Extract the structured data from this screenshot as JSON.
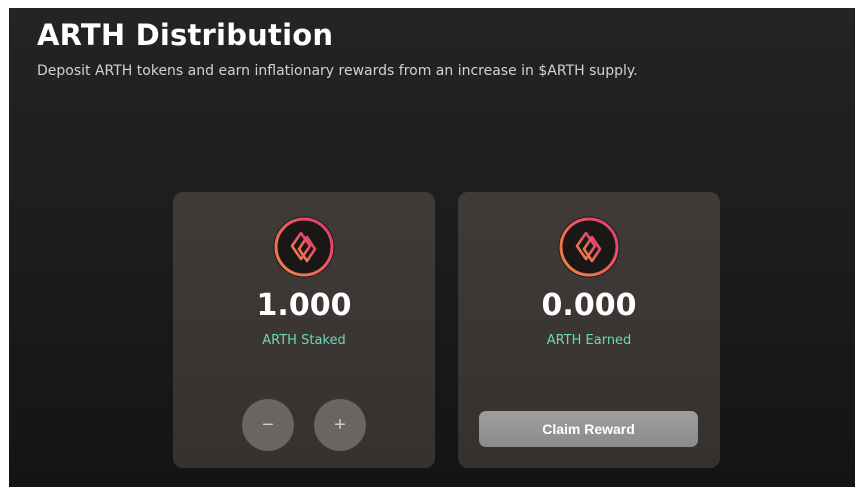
{
  "header": {
    "title": "ARTH Distribution",
    "subtitle": "Deposit ARTH tokens and earn inflationary rewards from an increase in $ARTH supply."
  },
  "staked_card": {
    "icon": "arth-token-icon",
    "amount": "1.000",
    "label": "ARTH Staked",
    "minus_label": "−",
    "plus_label": "+"
  },
  "earned_card": {
    "icon": "arth-token-icon",
    "amount": "0.000",
    "label": "ARTH Earned",
    "claim_label": "Claim Reward"
  },
  "colors": {
    "accent_label": "#6ad7b6",
    "logo_gradient_start": "#f08a3c",
    "logo_gradient_end": "#e0357c",
    "card_background": "#3d3836",
    "button_gray": "#9a9a9a"
  }
}
